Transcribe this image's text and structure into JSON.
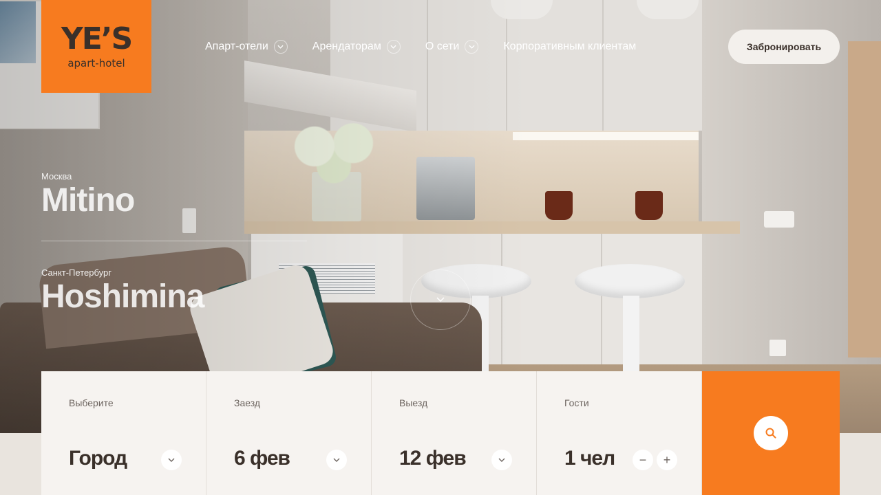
{
  "brand": {
    "logo_word": "YE’S",
    "logo_sub": "apart-hotel",
    "accent": "#f77b1f"
  },
  "nav": {
    "items": [
      {
        "label": "Апарт-отели",
        "has_dropdown": true
      },
      {
        "label": "Арендаторам",
        "has_dropdown": true
      },
      {
        "label": "О сети",
        "has_dropdown": true
      },
      {
        "label": "Корпоративным клиентам",
        "has_dropdown": false
      }
    ],
    "book_label": "Забронировать"
  },
  "locations": [
    {
      "city": "Москва",
      "name": "Mitino"
    },
    {
      "city": "Санкт-Петербург",
      "name": "Hoshimina"
    }
  ],
  "booking": {
    "city": {
      "label": "Выберите",
      "value": "Город"
    },
    "checkin": {
      "label": "Заезд",
      "value": "6 фев"
    },
    "checkout": {
      "label": "Выезд",
      "value": "12 фев"
    },
    "guests": {
      "label": "Гости",
      "value": "1 чел",
      "minus": "−",
      "plus": "+"
    }
  },
  "icons": [
    "chevron-down-icon",
    "search-icon",
    "minus-icon",
    "plus-icon"
  ]
}
